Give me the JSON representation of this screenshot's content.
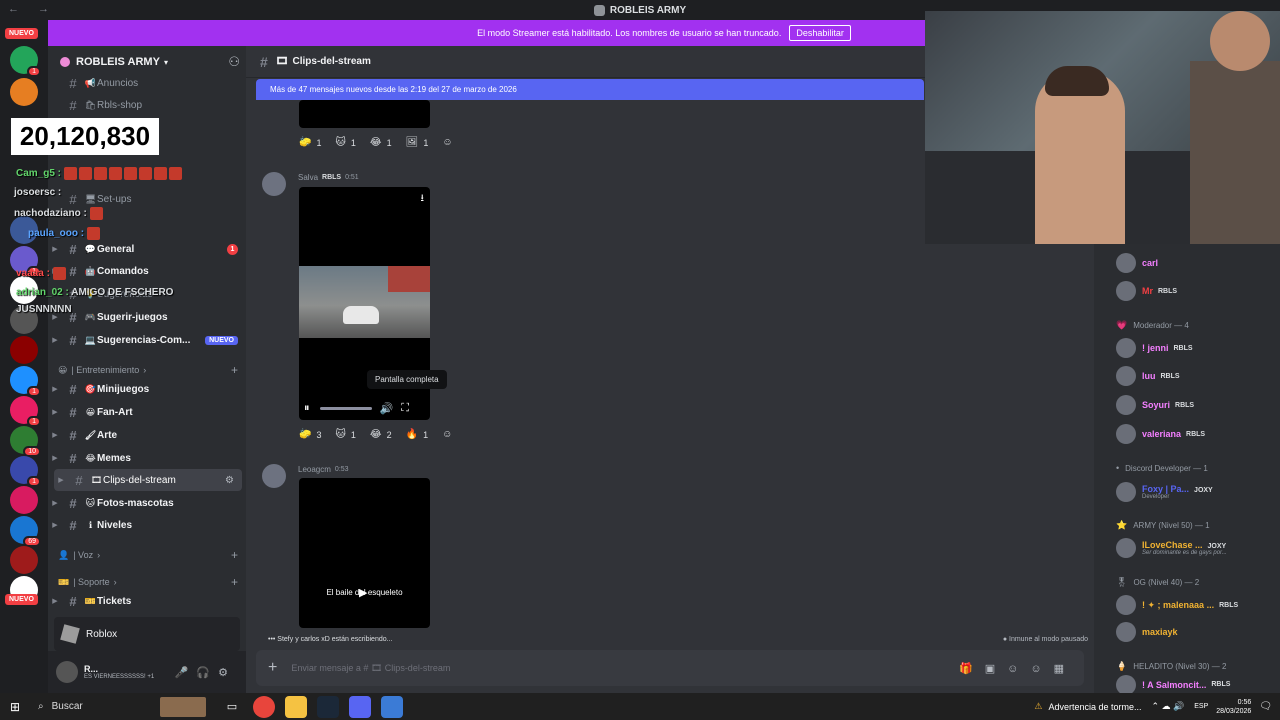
{
  "titlebar": {
    "title": "ROBLEIS ARMY"
  },
  "banner": {
    "text": "El modo Streamer está habilitado. Los nombres de usuario se han truncado.",
    "button": "Deshabilitar"
  },
  "guilds": {
    "nuevo_top": "NUEVO",
    "nuevo_bottom": "NUEVO",
    "badges": [
      "1",
      "1",
      "1",
      "1",
      "1",
      "10",
      "1",
      "69"
    ]
  },
  "overlay": {
    "counter": "20,120,830",
    "chat": [
      {
        "user": "Cam_g5 :",
        "color": "#62d56b"
      },
      {
        "user": "josoersc :",
        "color": "#ffffff"
      },
      {
        "user": "nachodaziano :",
        "color": "#ffffff"
      },
      {
        "user": "paula_ooo :",
        "color": "#5aa4ff"
      },
      {
        "user": "vaaaa :",
        "color": "#ff4c4c"
      },
      {
        "user": "adrian_02 :",
        "color": "#62d56b"
      },
      {
        "user": "AMIGO DE FSCHERO",
        "color": "#ffffff"
      },
      {
        "user": "JUSNNNNN",
        "color": "#ffffff"
      }
    ]
  },
  "sidebar": {
    "server_name": "ROBLEIS ARMY",
    "channels": [
      {
        "name": "Anuncios",
        "emoji": "📢",
        "bright": false
      },
      {
        "name": "Rbls-shop",
        "emoji": "🛍",
        "bright": false
      },
      {
        "name": "Set-ups",
        "emoji": "🖥",
        "bright": false
      },
      {
        "name": "General",
        "emoji": "💬",
        "bright": true,
        "count": "1"
      },
      {
        "name": "Comandos",
        "emoji": "🤖",
        "bright": true
      },
      {
        "name": "Sugerencias",
        "emoji": "💡",
        "bright": false
      },
      {
        "name": "Sugerir-juegos",
        "emoji": "🎮",
        "bright": true
      },
      {
        "name": "Sugerencias-Com...",
        "emoji": "💻",
        "bright": true,
        "pill": "NUEVO"
      }
    ],
    "category_entretenimiento": "| Entretenimiento",
    "entretenimiento": [
      {
        "name": "Minijuegos",
        "emoji": "🎯"
      },
      {
        "name": "Fan-Art",
        "emoji": "😀"
      },
      {
        "name": "Arte",
        "emoji": "🖌"
      },
      {
        "name": "Memes",
        "emoji": "😂"
      },
      {
        "name": "Clips-del-stream",
        "emoji": "🎞",
        "selected": true
      },
      {
        "name": "Fotos-mascotas",
        "emoji": "🐱"
      },
      {
        "name": "Niveles",
        "emoji": "ℹ"
      }
    ],
    "category_voz": "| Voz",
    "category_soporte": "| Soporte",
    "soporte": [
      {
        "name": "Tickets",
        "emoji": "🎫"
      }
    ],
    "roblox": "Roblox",
    "user": {
      "name": "R...",
      "status": "ES VIERNEESSSSSS! +1"
    }
  },
  "chat": {
    "channel": "Clips-del-stream",
    "new_messages": "Más de 47 mensajes nuevos desde las 2:19 del 27 de marzo de 2026",
    "reactions_top": [
      {
        "emoji": "🧽",
        "count": "1"
      },
      {
        "emoji": "🐱",
        "count": "1"
      },
      {
        "emoji": "😂",
        "count": "1"
      },
      {
        "emoji": "🖼",
        "count": "1"
      }
    ],
    "msg1": {
      "author": "Salva",
      "tag": "RBLS",
      "time": "0:51"
    },
    "tooltip": "Pantalla completa",
    "reactions_mid": [
      {
        "emoji": "🧽",
        "count": "3"
      },
      {
        "emoji": "🐱",
        "count": "1"
      },
      {
        "emoji": "😂",
        "count": "2"
      },
      {
        "emoji": "🔥",
        "count": "1"
      }
    ],
    "msg2": {
      "author": "Leoagcm",
      "time": "0:53",
      "video_caption": "El baile del esqueleto"
    },
    "typing": "Stefy y carlos xD están escribiendo...",
    "immune": "Inmune al modo pausado",
    "composer_placeholder": "Enviar mensaje a # 🎞 Clips-del-stream"
  },
  "members": {
    "top": [
      {
        "name": "carl",
        "color": "#f47fff"
      },
      {
        "name": "Mr",
        "color": "#f23f43",
        "tag": "RBLS"
      }
    ],
    "moderador_header": "Moderador — 4",
    "moderadores": [
      {
        "name": "! jenni",
        "color": "#f47fff",
        "tag": "RBLS"
      },
      {
        "name": "luu",
        "color": "#f47fff",
        "tag": "RBLS"
      },
      {
        "name": "Soyuri",
        "color": "#f47fff",
        "tag": "RBLS"
      },
      {
        "name": "valeriana",
        "color": "#f47fff",
        "tag": "RBLS"
      }
    ],
    "dev_header": "Discord Developer — 1",
    "dev": {
      "name": "Foxy | Pa...",
      "color": "#5865f2",
      "tag": "JOXY",
      "sub": "Developer"
    },
    "army_header": "ARMY (Nivel 50) — 1",
    "army": {
      "name": "ILoveChase ...",
      "color": "#f0b232",
      "tag": "JOXY",
      "sub": "Ser dominante es de gays por..."
    },
    "og_header": "OG (Nivel 40) — 2",
    "og": [
      {
        "name": "! ✦ ; malenaaa ...",
        "color": "#f0b232",
        "tag": "RBLS"
      },
      {
        "name": "maxiayk",
        "color": "#f0b232"
      }
    ],
    "heladito_header": "HELADITO (Nivel 30) — 2",
    "heladito": {
      "name": "! A Salmoncit...",
      "color": "#f47fff",
      "tag": "RBLS"
    }
  },
  "taskbar": {
    "search": "Buscar",
    "warning": "Advertencia de torme...",
    "lang": "ESP",
    "time": "0:56",
    "date": "28/03/2026"
  }
}
